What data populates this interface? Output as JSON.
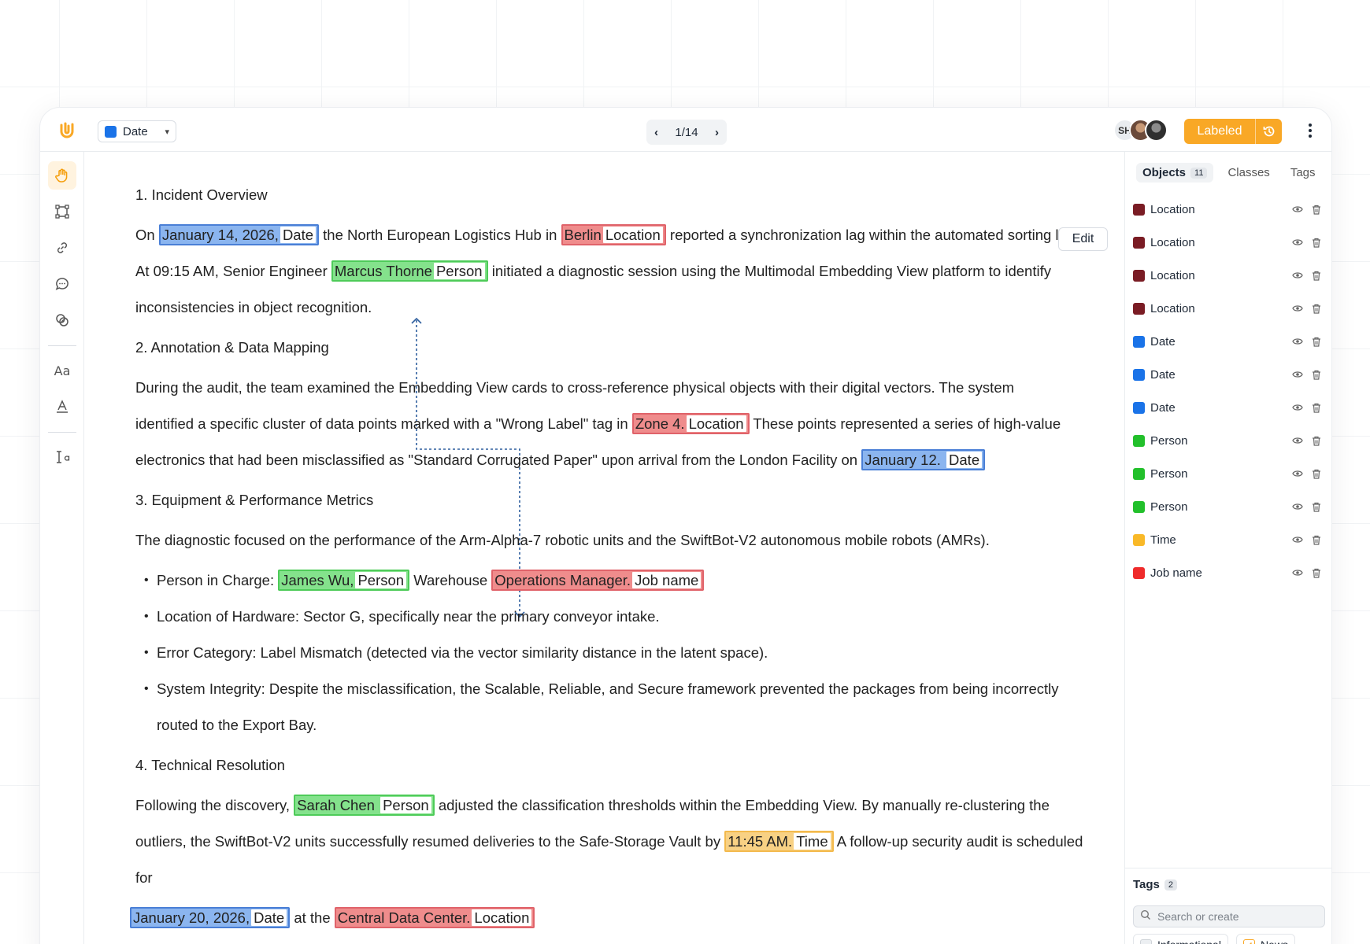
{
  "toolbar": {
    "class_select": {
      "label": "Date",
      "color": "#1a73e8"
    },
    "pager": "1/14",
    "avatar_initials": "SH",
    "status_button": "Labeled",
    "status_color": "#f9a826"
  },
  "document": {
    "edit_label": "Edit",
    "h1": "1. Incident Overview",
    "p1_l1": {
      "a": "On ",
      "e1": "January 14, 2026,",
      "e1l": "Date",
      "b": " the North European Logistics Hub in ",
      "e2": "Berlin",
      "e2l": "Location",
      "c": "  reported a synchronization lag within the automated sorting lane."
    },
    "p1_l2": {
      "a": "At 09:15 AM, Senior Engineer ",
      "e1": "Marcus Thorne",
      "e1l": "Person",
      "b": "  initiated a diagnostic session using the Multimodal Embedding View platform to identify"
    },
    "p1_l3": "inconsistencies in object recognition.",
    "h2": "2. Annotation & Data Mapping",
    "p2_l1": "During the audit, the team examined the Embedding View cards to cross-reference physical objects with their digital vectors. The system",
    "p2_l2": {
      "a": "identified a specific cluster of data points marked with a \"Wrong Label\" tag in ",
      "e1": "Zone 4.",
      "e1l": "Location",
      "b": " These points represented a series of high-value"
    },
    "p2_l3": {
      "a": "electronics that had been misclassified as \"Standard Corrugated Paper\" upon arrival from the London Facility on ",
      "e1": "January 12. ",
      "e1l": "Date"
    },
    "h3": "3. Equipment & Performance Metrics",
    "p3": "The diagnostic focused on the performance of the Arm-Alpha-7 robotic units and the SwiftBot-V2 autonomous mobile robots (AMRs).",
    "b1": {
      "a": "Person in Charge: ",
      "e1": "James Wu,",
      "e1l": "Person",
      "b": " Warehouse ",
      "e2": "Operations Manager.",
      "e2l": "Job name"
    },
    "b2": "Location of Hardware: Sector G, specifically near the primary conveyor intake.",
    "b3": "Error Category: Label Mismatch (detected via the vector similarity distance in the latent space).",
    "b4_l1": "System Integrity: Despite the misclassification, the Scalable, Reliable, and Secure framework prevented the packages from being incorrectly",
    "b4_l2": "routed to the Export Bay.",
    "h4": "4. Technical Resolution",
    "p4_l1": {
      "a": "Following the discovery, ",
      "e1": "Sarah Chen ",
      "e1l": "Person",
      "b": " adjusted the classification thresholds within the Embedding View. By manually re-clustering the"
    },
    "p4_l2": {
      "a": "outliers, the SwiftBot-V2 units successfully resumed deliveries to the Safe-Storage Vault by ",
      "e1": "11:45 AM.",
      "e1l": "Time",
      "b": " A follow-up security audit is scheduled"
    },
    "p4_l3": "for",
    "p4_l4": {
      "e1": "January 20, 2026,",
      "e1l": "Date",
      "a": " at the ",
      "e2": "Central Data Center.",
      "e2l": "Location"
    }
  },
  "sidebar": {
    "tabs": [
      {
        "label": "Objects",
        "count": "11"
      },
      {
        "label": "Classes"
      },
      {
        "label": "Tags"
      }
    ],
    "objects": [
      {
        "label": "Location",
        "color": "#7a1c24"
      },
      {
        "label": "Location",
        "color": "#7a1c24"
      },
      {
        "label": "Location",
        "color": "#7a1c24"
      },
      {
        "label": "Location",
        "color": "#7a1c24"
      },
      {
        "label": "Date",
        "color": "#1a73e8"
      },
      {
        "label": "Date",
        "color": "#1a73e8"
      },
      {
        "label": "Date",
        "color": "#1a73e8"
      },
      {
        "label": "Person",
        "color": "#22c02b"
      },
      {
        "label": "Person",
        "color": "#22c02b"
      },
      {
        "label": "Person",
        "color": "#22c02b"
      },
      {
        "label": "Time",
        "color": "#f9b928"
      },
      {
        "label": "Job name",
        "color": "#ef2b2b"
      }
    ],
    "tags_title": "Tags",
    "tags_count": "2",
    "search_placeholder": "Search or create",
    "tag_chips": [
      {
        "label": "Informational",
        "checked": false
      },
      {
        "label": "News",
        "checked": true
      }
    ]
  }
}
